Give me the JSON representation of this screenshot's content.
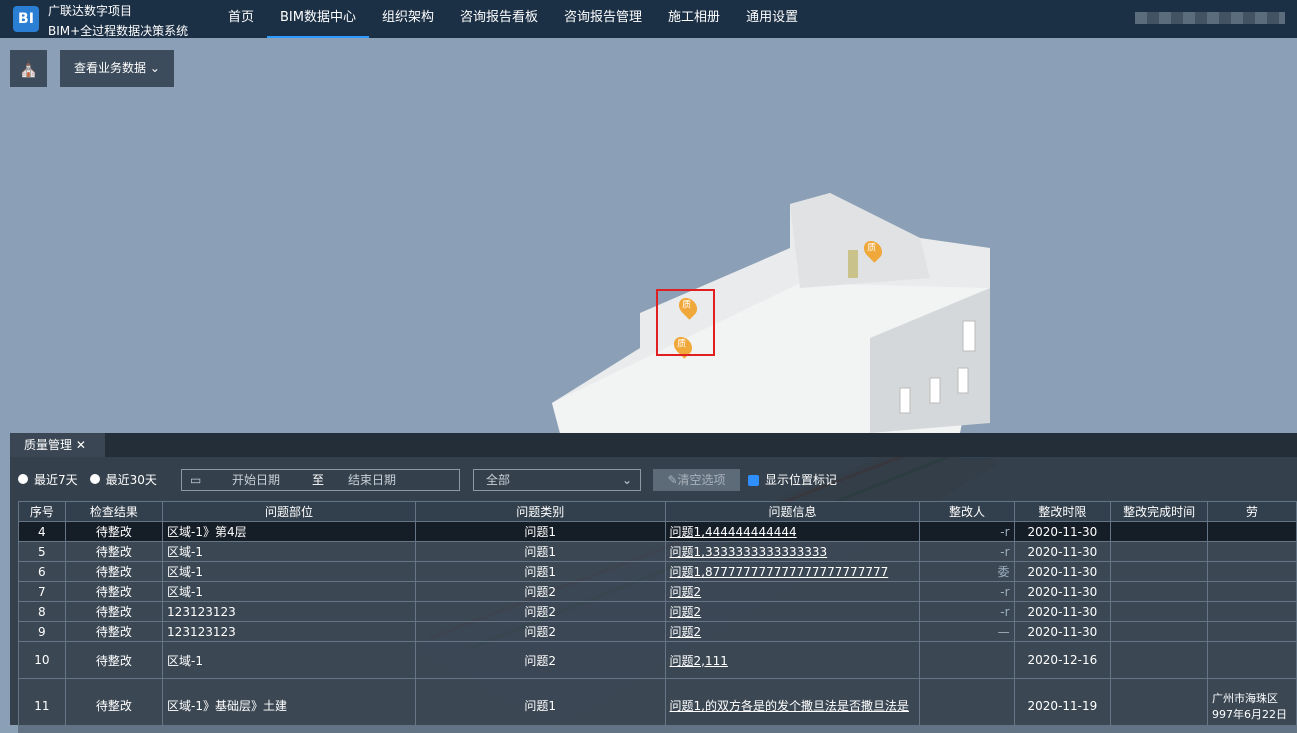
{
  "header": {
    "logo_text": "BI",
    "project_name": "广联达数字项目",
    "system_name": "BIM+全过程数据决策系统",
    "nav": [
      "首页",
      "BIM数据中心",
      "组织架构",
      "咨询报告看板",
      "咨询报告管理",
      "施工相册",
      "通用设置"
    ],
    "active_nav": "BIM数据中心"
  },
  "toolbar": {
    "hierarchy_icon": "sitemap-icon",
    "business_data_label": "查看业务数据"
  },
  "markers": [
    {
      "label": "质"
    },
    {
      "label": "质"
    },
    {
      "label": "质"
    }
  ],
  "panel": {
    "tab_label": "质量管理",
    "filters": {
      "recent7": "最近7天",
      "recent30": "最近30天",
      "start_placeholder": "开始日期",
      "date_sep": "至",
      "end_placeholder": "结束日期",
      "category_value": "全部",
      "clear_label": "清空选项",
      "show_marker_label": "显示位置标记"
    },
    "table": {
      "headers": [
        "序号",
        "检查结果",
        "问题部位",
        "问题类别",
        "问题信息",
        "整改人",
        "整改时限",
        "整改完成时间",
        "劳"
      ],
      "rows": [
        [
          "4",
          "待整改",
          "区域-1》第4层",
          "问题1",
          "问题1,444444444444",
          "-r",
          "2020-11-30",
          "",
          ""
        ],
        [
          "5",
          "待整改",
          "区域-1",
          "问题1",
          "问题1,3333333333333333",
          "-r",
          "2020-11-30",
          "",
          ""
        ],
        [
          "6",
          "待整改",
          "区域-1",
          "问题1",
          "问题1,877777777777777777777777",
          "委",
          "2020-11-30",
          "",
          ""
        ],
        [
          "7",
          "待整改",
          "区域-1",
          "问题2",
          "问题2",
          "-r",
          "2020-11-30",
          "",
          ""
        ],
        [
          "8",
          "待整改",
          "123123123",
          "问题2",
          "问题2",
          "-r",
          "2020-11-30",
          "",
          ""
        ],
        [
          "9",
          "待整改",
          "123123123",
          "问题2",
          "问题2",
          "—",
          "2020-11-30",
          "",
          ""
        ],
        [
          "10",
          "待整改",
          "区域-1",
          "问题2",
          "问题2,111",
          "",
          "2020-12-16",
          "",
          ""
        ],
        [
          "11",
          "待整改",
          "区域-1》基础层》土建",
          "问题1",
          "问题1,的双方各是的发个撒旦法是否撒旦法是",
          "",
          "2020-11-19",
          "",
          "广州市海珠区 997年6月22日"
        ]
      ]
    }
  }
}
